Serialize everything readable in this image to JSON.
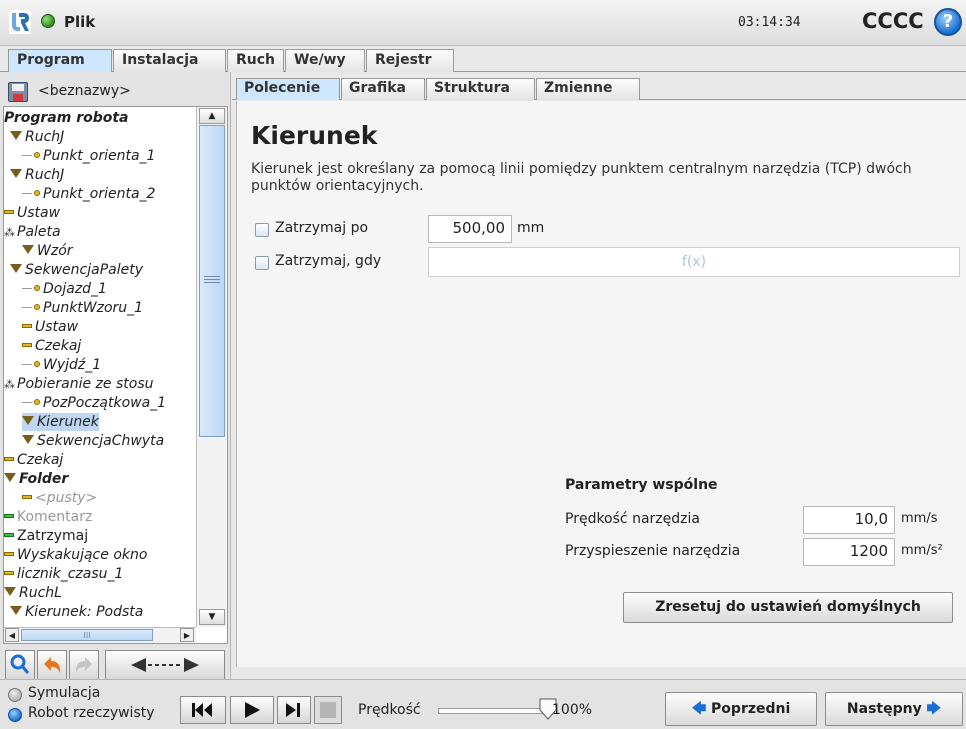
{
  "header": {
    "file_label": "Plik",
    "time": "03:14:34",
    "robot_name": "CCCC",
    "help_symbol": "?"
  },
  "main_tabs": [
    "Program",
    "Instalacja",
    "Ruch",
    "We/wy",
    "Rejestr"
  ],
  "left": {
    "program_name": "<beznazwy>",
    "tree": [
      {
        "label": "Program robota",
        "icon": "none",
        "bold": true
      },
      {
        "label": "RuchJ",
        "icon": "triangle"
      },
      {
        "label": "Punkt_orienta_1",
        "icon": "waypoint"
      },
      {
        "label": "RuchJ",
        "icon": "triangle"
      },
      {
        "label": "Punkt_orienta_2",
        "icon": "waypoint"
      },
      {
        "label": "Ustaw",
        "icon": "bar"
      },
      {
        "label": "Paleta",
        "icon": "pallet"
      },
      {
        "label": "Wzór",
        "icon": "triangle"
      },
      {
        "label": "SekwencjaPalety",
        "icon": "triangle"
      },
      {
        "label": "Dojazd_1",
        "icon": "waypoint"
      },
      {
        "label": "PunktWzoru_1",
        "icon": "waypoint"
      },
      {
        "label": "Ustaw",
        "icon": "bar"
      },
      {
        "label": "Czekaj",
        "icon": "bar"
      },
      {
        "label": "Wyjdź_1",
        "icon": "waypoint"
      },
      {
        "label": "Pobieranie ze stosu",
        "icon": "pallet"
      },
      {
        "label": "PozPoczątkowa_1",
        "icon": "waypoint"
      },
      {
        "label": "Kierunek",
        "icon": "triangle",
        "selected": true
      },
      {
        "label": "SekwencjaChwyta",
        "icon": "triangle"
      },
      {
        "label": "Czekaj",
        "icon": "bar"
      },
      {
        "label": "Folder",
        "icon": "triangle",
        "bold": true
      },
      {
        "label": "<pusty>",
        "icon": "bar",
        "gray": true
      },
      {
        "label": "Komentarz",
        "icon": "bar-green",
        "gray": true
      },
      {
        "label": "Zatrzymaj",
        "icon": "bar-green"
      },
      {
        "label": "Wyskakujące okno",
        "icon": "bar"
      },
      {
        "label": "licznik_czasu_1",
        "icon": "bar"
      },
      {
        "label": "RuchL",
        "icon": "triangle"
      },
      {
        "label": "Kierunek: Podsta",
        "icon": "triangle"
      }
    ],
    "scrollbar_hscroll_grip": "III"
  },
  "sub_tabs": [
    "Polecenie",
    "Grafika",
    "Struktura",
    "Zmienne"
  ],
  "command": {
    "title": "Kierunek",
    "description": "Kierunek jest określany za pomocą linii pomiędzy punktem centralnym narzędzia (TCP) dwóch punktów orientacyjnych.",
    "stop_after_label": "Zatrzymaj po",
    "stop_after_value": "500,00",
    "stop_after_unit": "mm",
    "stop_when_label": "Zatrzymaj, gdy",
    "stop_when_placeholder": "f(x)",
    "shared_params_title": "Parametry wspólne",
    "tool_speed_label": "Prędkość narzędzia",
    "tool_speed_value": "10,0",
    "tool_speed_unit": "mm/s",
    "tool_accel_label": "Przyspieszenie narzędzia",
    "tool_accel_value": "1200",
    "tool_accel_unit": "mm/s²",
    "reset_button": "Zresetuj do ustawień domyślnych"
  },
  "bottom": {
    "simulation_label": "Symulacja",
    "real_robot_label": "Robot rzeczywisty",
    "speed_label": "Prędkość",
    "speed_value": "100%",
    "speed_fraction": 1.0,
    "prev_button": "Poprzedni",
    "next_button": "Następny"
  },
  "colors": {
    "selection": "#bcd6f3",
    "active_tab": "#cfe6ff",
    "waypoint": "#e2b923",
    "green_node": "#3fbf3f"
  }
}
